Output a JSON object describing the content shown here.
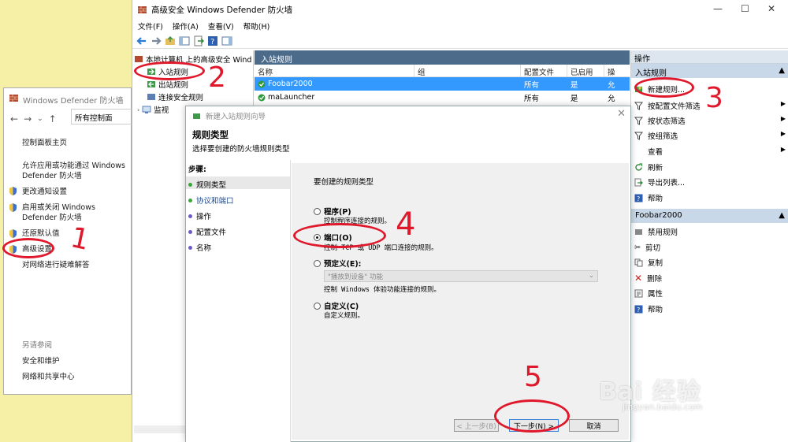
{
  "control_panel": {
    "title": "Windows Defender 防火墙",
    "address": "所有控制面",
    "links": [
      "控制面板主页",
      "允许应用或功能通过 Windows",
      "Defender 防火墙",
      "更改通知设置",
      "启用或关闭 Windows",
      "Defender 防火墙",
      "还原默认值",
      "高级设置",
      "对网络进行疑难解答"
    ],
    "see_also": "另请参阅",
    "see_also_links": [
      "安全和维护",
      "网络和共享中心"
    ]
  },
  "main_window": {
    "title": "高级安全 Windows Defender 防火墙",
    "menu": [
      "文件(F)",
      "操作(A)",
      "查看(V)",
      "帮助(H)"
    ],
    "tree": {
      "root": "本地计算机 上的高级安全 Wind",
      "items": [
        "入站规则",
        "出站规则",
        "连接安全规则",
        "监视"
      ]
    },
    "list": {
      "header": "入站规则",
      "columns": [
        "名称",
        "组",
        "配置文件",
        "已启用",
        "操"
      ],
      "rows": [
        {
          "name": "Foobar2000",
          "group": "",
          "profile": "所有",
          "enabled": "是",
          "action": "允"
        },
        {
          "name": "maLauncher",
          "group": "",
          "profile": "所有",
          "enabled": "是",
          "action": "允"
        }
      ]
    },
    "actions": {
      "header": "操作",
      "section1": "入站规则",
      "items1": [
        "新建规则...",
        "按配置文件筛选",
        "按状态筛选",
        "按组筛选",
        "查看",
        "刷新",
        "导出列表...",
        "帮助"
      ],
      "section2": "Foobar2000",
      "items2": [
        "禁用规则",
        "剪切",
        "复制",
        "删除",
        "属性",
        "帮助"
      ]
    }
  },
  "wizard": {
    "title": "新建入站规则向导",
    "heading": "规则类型",
    "subheading": "选择要创建的防火墙规则类型",
    "steps_label": "步骤:",
    "steps": [
      "规则类型",
      "协议和端口",
      "操作",
      "配置文件",
      "名称"
    ],
    "prompt": "要创建的规则类型",
    "options": [
      {
        "label": "程序(P)",
        "desc": "控制程序连接的规则。"
      },
      {
        "label": "端口(O)",
        "desc": "控制 TCP 或 UDP 端口连接的规则。"
      },
      {
        "label": "预定义(E):",
        "desc": "控制 Windows 体验功能连接的规则。"
      },
      {
        "label": "自定义(C)",
        "desc": "自定义规则。"
      }
    ],
    "predefined_select": "\"播放到设备\" 功能",
    "buttons": {
      "back": "< 上一步(B)",
      "next": "下一步(N) >",
      "cancel": "取消"
    }
  },
  "annotations": [
    "1",
    "2",
    "3",
    "4",
    "5"
  ],
  "watermark": {
    "brand": "Bai 经验",
    "url": "jingyan.baidu.com"
  },
  "accent": "#e0182c"
}
